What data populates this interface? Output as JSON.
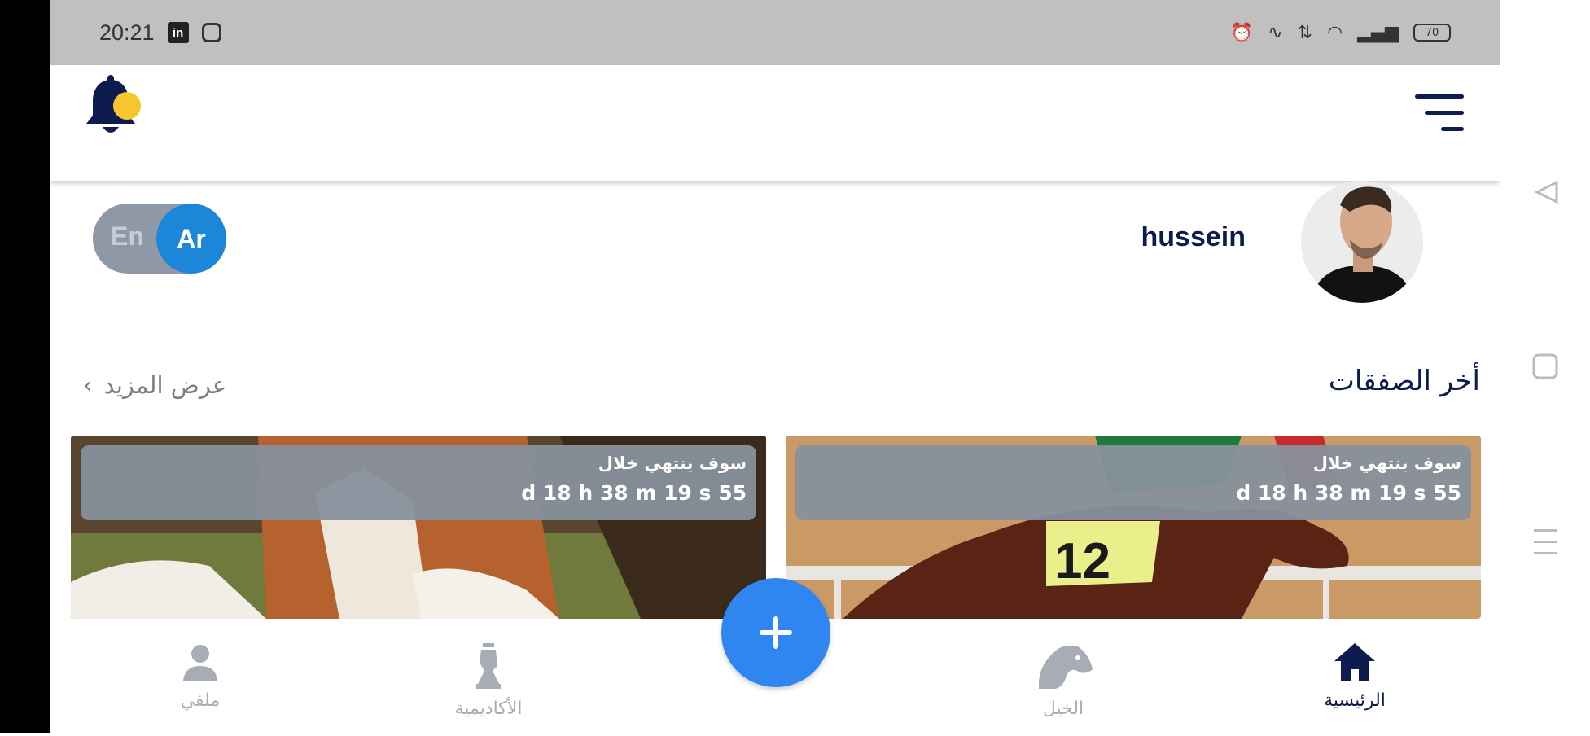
{
  "status_bar": {
    "time": "20:21",
    "battery": "70"
  },
  "language_toggle": {
    "inactive": "En",
    "active": "Ar"
  },
  "user": {
    "name": "hussein"
  },
  "section": {
    "title": "أخر الصفقات",
    "more_label": "عرض المزيد"
  },
  "cards": [
    {
      "label": "سوف ينتهي خلال",
      "countdown": "d 18 h 38 m 19 s 55"
    },
    {
      "label": "سوف ينتهي خلال",
      "countdown": "d 18 h 38 m 19 s 55"
    }
  ],
  "bottom_nav": {
    "home": "الرئيسية",
    "horses": "الخيل",
    "academy": "الأكاديمية",
    "profile": "ملفي"
  },
  "colors": {
    "primary": "#0d1b4f",
    "accent": "#1c87d8",
    "fab": "#2f86f0",
    "bell_dot": "#f7c62f"
  }
}
